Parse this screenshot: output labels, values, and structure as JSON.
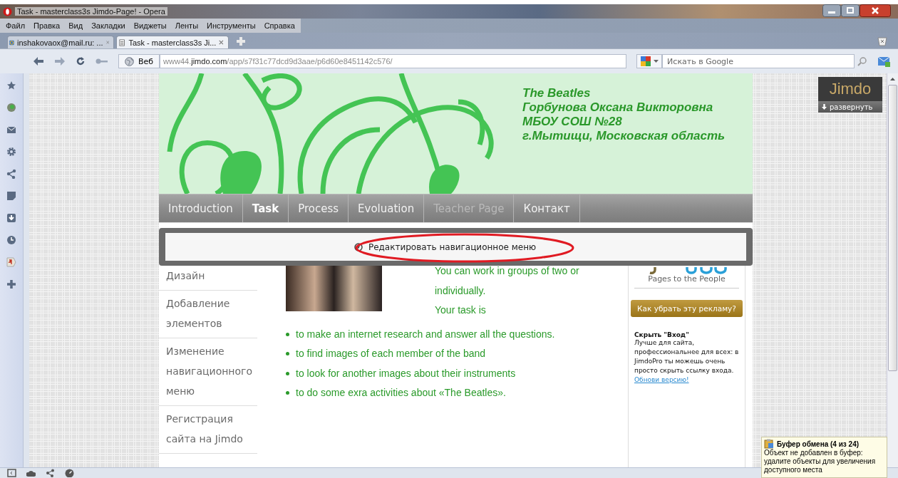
{
  "window": {
    "title": "Task - masterclass3s Jimdo-Page! - Opera"
  },
  "menu": [
    "Файл",
    "Правка",
    "Вид",
    "Закладки",
    "Виджеты",
    "Ленты",
    "Инструменты",
    "Справка"
  ],
  "tabs": [
    {
      "label": "inshakovaox@mail.ru: ...",
      "selected": false,
      "kind": "mail"
    },
    {
      "label": "Task - masterclass3s Ji...",
      "selected": true,
      "kind": "page"
    }
  ],
  "address_bar": {
    "site_button": "Веб",
    "url": "www44.**jimdo.com**/app/s7f31c77dcd9d3aae/p6d60e8451142c576/"
  },
  "search": {
    "placeholder": "Искать в Google"
  },
  "site": {
    "header_lines": [
      "The Beatles",
      "Горбунова Оксана Викторовна",
      "МБОУ СОШ №28",
      "г.Мытищи, Московская область"
    ],
    "nav": [
      {
        "label": "Introduction",
        "selected": false,
        "disabled": false
      },
      {
        "label": "Task",
        "selected": true,
        "disabled": false
      },
      {
        "label": "Process",
        "selected": false,
        "disabled": false
      },
      {
        "label": "Evoluation",
        "selected": false,
        "disabled": false
      },
      {
        "label": "Teacher Page",
        "selected": false,
        "disabled": true
      },
      {
        "label": "Контакт",
        "selected": false,
        "disabled": false
      }
    ],
    "edit_bar": {
      "label": "Редактировать навигационное меню"
    },
    "subnav": [
      "Дизайн",
      "Добавление элементов",
      "Изменение навигационного меню",
      "Регистрация сайта на Jimdo"
    ],
    "intro_lines": [
      "You can  work in groups of two or",
      "individually.",
      "Your task is"
    ],
    "bullets": [
      "to make an internet research and answer all the questions.",
      "to find images of each member of the band",
      "to look for another images about their instruments",
      "to do some exra activities about «The Beatles»."
    ],
    "sidebar": {
      "tagline": "Pages to the People",
      "ad_button": "Как убрать эту рекламу?",
      "heading": "Скрыть \"Вход\"",
      "text": "Лучше для сайта, профессиональнее для всех: в JimdoPro ты можешь очень просто скрыть ссылку входа.",
      "link": "Обнови версию!"
    }
  },
  "jimdo_badge": {
    "logo": "Jimdo",
    "expand": "развернуть"
  },
  "clipboard_tip": {
    "title": "Буфер обмена (4 из 24)",
    "text": "Объект не добавлен в буфер: удалите объекты для увеличения доступного места"
  }
}
